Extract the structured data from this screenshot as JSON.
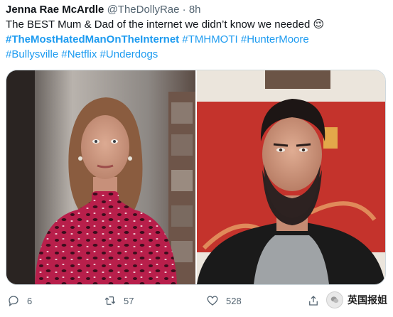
{
  "tweet": {
    "author_name": "Jenna Rae McArdle",
    "handle_time": "@TheDollyRae · 8h",
    "text_main": "The BEST Mum & Dad of the internet we didn’t know we needed ",
    "emoji": "😌",
    "hashtags_line1": [
      {
        "text": "#TheMostHatedManOnTheInternet",
        "bold": true
      },
      {
        "text": " #TMHMOTI",
        "bold": false
      },
      {
        "text": " #HunterMoore",
        "bold": false
      }
    ],
    "hashtags_line2": [
      {
        "text": "#Bullysville",
        "bold": false
      },
      {
        "text": " #Netflix",
        "bold": false
      },
      {
        "text": " #Underdogs",
        "bold": false
      }
    ]
  },
  "media": {
    "left_photo": "woman-portrait",
    "right_photo": "man-portrait"
  },
  "actions": {
    "reply_count": "6",
    "retweet_count": "57",
    "like_count": "528"
  },
  "watermark": {
    "text": "英国报姐"
  },
  "colors": {
    "link": "#1d9bf0",
    "secondary_text": "#536471",
    "flag_red": "#c4332c"
  }
}
